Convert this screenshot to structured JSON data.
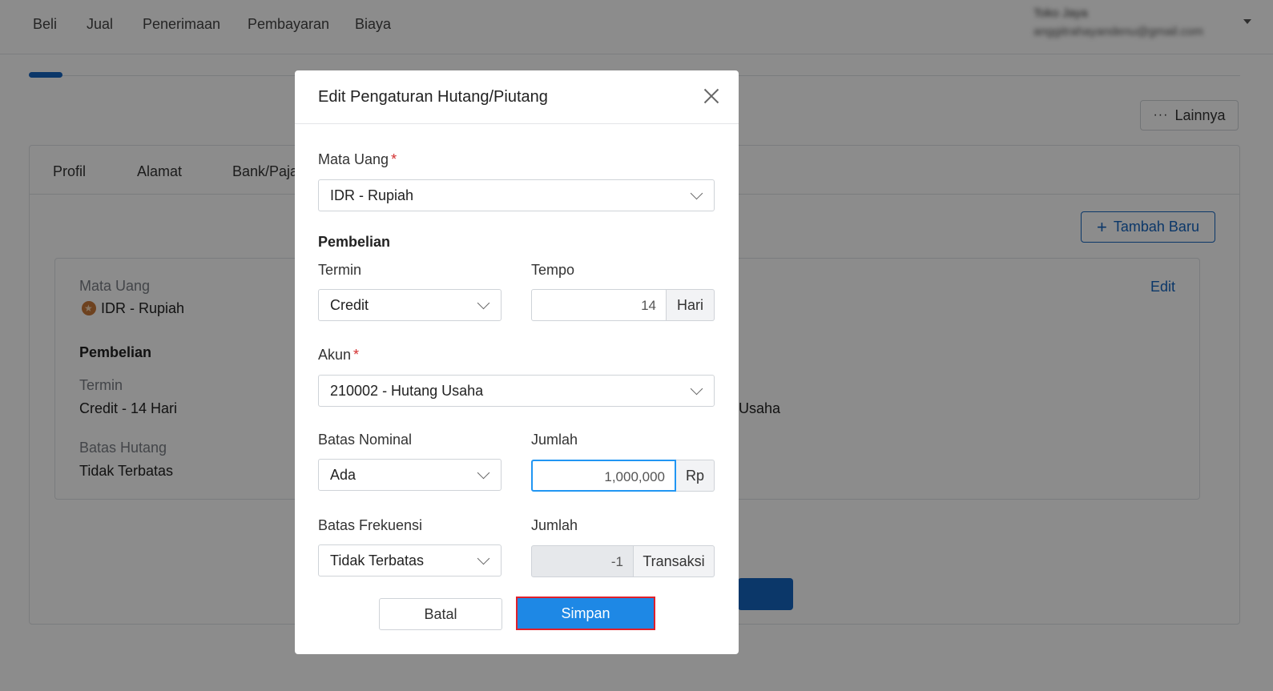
{
  "topnav": {
    "items": [
      "Beli",
      "Jual",
      "Penerimaan",
      "Pembayaran",
      "Biaya"
    ],
    "user_name": "Toko Jaya",
    "user_email": "anggitrahayandenu@gmail.com"
  },
  "page": {
    "lainnya_label": "Lainnya",
    "tabs": [
      "Profil",
      "Alamat",
      "Bank/Pajak"
    ],
    "tambah_label": "Tambah Baru",
    "edit_label": "Edit",
    "card": {
      "mata_uang_label": "Mata Uang",
      "mata_uang_value": "IDR - Rupiah",
      "pembelian_title": "Pembelian",
      "termin_label": "Termin",
      "termin_value": "Credit - 14 Hari",
      "akun_value_fragment": "Usaha",
      "batas_hutang_label": "Batas Hutang",
      "batas_hutang_value": "Tidak Terbatas"
    }
  },
  "modal": {
    "title": "Edit Pengaturan Hutang/Piutang",
    "mata_uang": {
      "label": "Mata Uang",
      "value": "IDR - Rupiah"
    },
    "pembelian_title": "Pembelian",
    "termin": {
      "label": "Termin",
      "value": "Credit"
    },
    "tempo": {
      "label": "Tempo",
      "value": "14",
      "unit": "Hari"
    },
    "akun": {
      "label": "Akun",
      "value": "210002 - Hutang Usaha"
    },
    "batas_nominal": {
      "label": "Batas Nominal",
      "value": "Ada"
    },
    "jumlah_nominal": {
      "label": "Jumlah",
      "value": "1,000,000",
      "unit": "Rp"
    },
    "batas_frekuensi": {
      "label": "Batas Frekuensi",
      "value": "Tidak Terbatas"
    },
    "jumlah_frekuensi": {
      "label": "Jumlah",
      "value": "-1",
      "unit": "Transaksi"
    },
    "batal_label": "Batal",
    "simpan_label": "Simpan"
  }
}
